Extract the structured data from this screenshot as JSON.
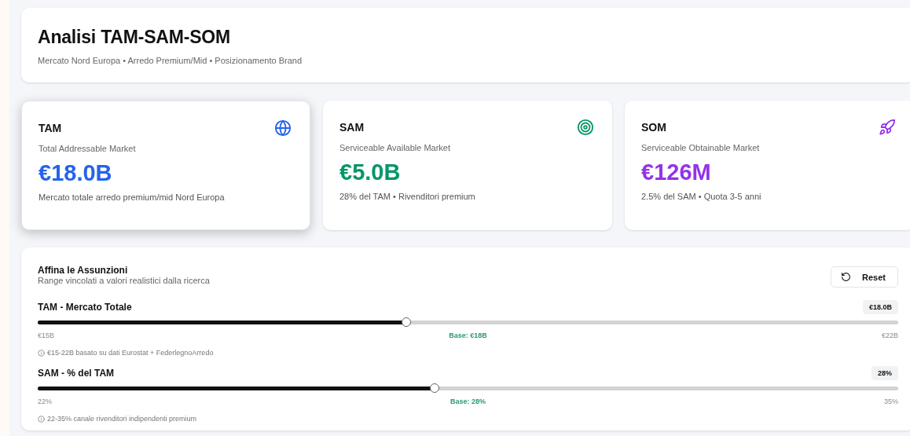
{
  "header": {
    "title": "Analisi TAM-SAM-SOM",
    "subtitle": "Mercato Nord Europa • Arredo Premium/Mid • Posizionamento Brand"
  },
  "cards": [
    {
      "kind": "globe",
      "label": "TAM",
      "description": "Total Addressable Market",
      "value": "€18.0B",
      "note": "Mercato totale arredo premium/mid Nord Europa",
      "color": "#2563eb",
      "selected": true
    },
    {
      "kind": "target",
      "label": "SAM",
      "description": "Serviceable Available Market",
      "value": "€5.0B",
      "note": "28% del TAM • Rivenditori premium",
      "color": "#059669",
      "selected": false
    },
    {
      "kind": "rocket",
      "label": "SOM",
      "description": "Serviceable Obtainable Market",
      "value": "€126M",
      "note": "2.5% del SAM • Quota 3-5 anni",
      "color": "#9333ea",
      "selected": false
    }
  ],
  "assumptions": {
    "title": "Affina le Assunzioni",
    "subtitle": "Range vincolati a valori realistici dalla ricerca",
    "reset_button": "Reset",
    "sliders": [
      {
        "label": "TAM - Mercato Totale",
        "reading": "€18.0B",
        "level": 0.4286,
        "min": "€15B",
        "base": "Base: €18B",
        "max": "€22B",
        "hint": "€15-22B basato su dati Eurostat + FederlegnoArredo"
      },
      {
        "label": "SAM - % del TAM",
        "reading": "28%",
        "level": 0.4615,
        "min": "22%",
        "base": "Base: 28%",
        "max": "35%",
        "hint": "22-35% canale rivenditori indipendenti premium"
      }
    ]
  }
}
